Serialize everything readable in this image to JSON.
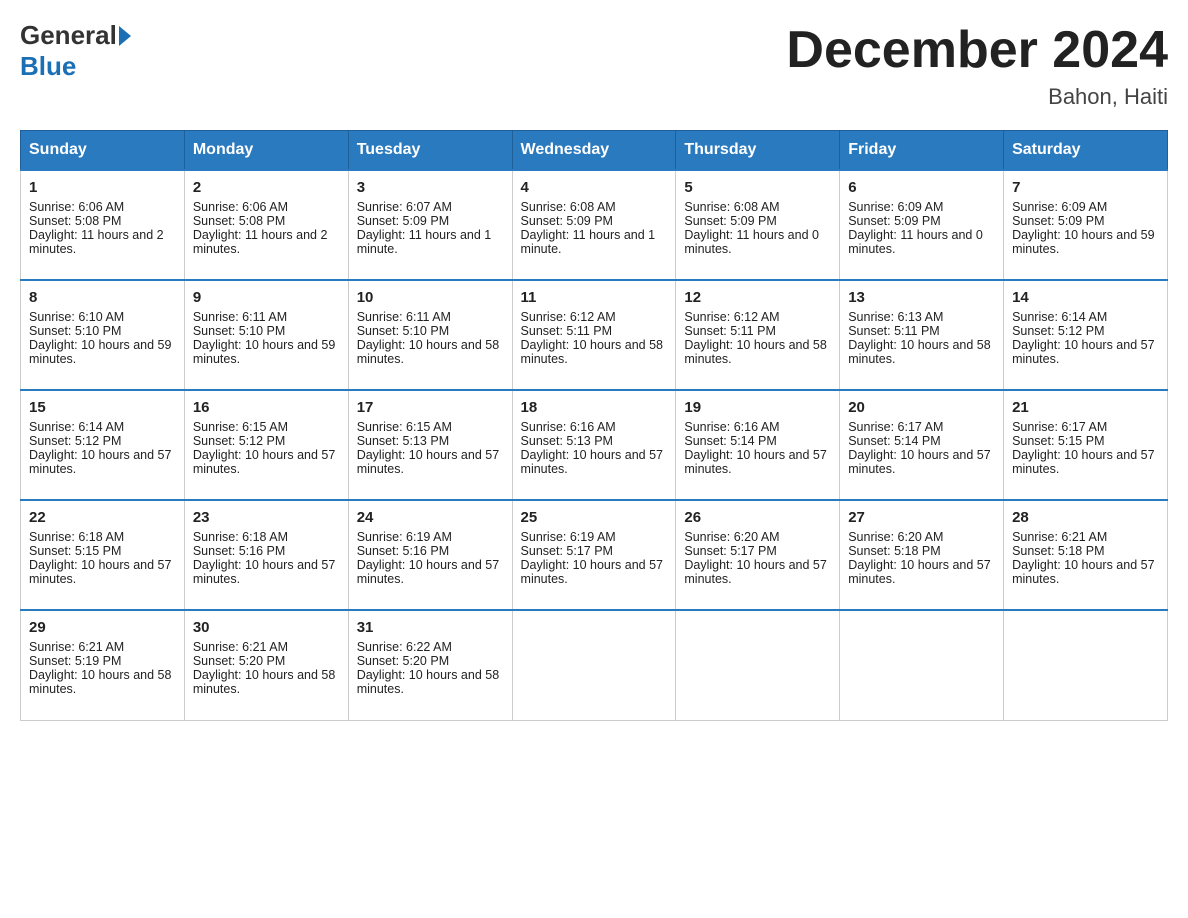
{
  "header": {
    "logo_general": "General",
    "logo_blue": "Blue",
    "month_title": "December 2024",
    "location": "Bahon, Haiti"
  },
  "days_of_week": [
    "Sunday",
    "Monday",
    "Tuesday",
    "Wednesday",
    "Thursday",
    "Friday",
    "Saturday"
  ],
  "weeks": [
    [
      {
        "day": "1",
        "sunrise": "6:06 AM",
        "sunset": "5:08 PM",
        "daylight": "11 hours and 2 minutes."
      },
      {
        "day": "2",
        "sunrise": "6:06 AM",
        "sunset": "5:08 PM",
        "daylight": "11 hours and 2 minutes."
      },
      {
        "day": "3",
        "sunrise": "6:07 AM",
        "sunset": "5:09 PM",
        "daylight": "11 hours and 1 minute."
      },
      {
        "day": "4",
        "sunrise": "6:08 AM",
        "sunset": "5:09 PM",
        "daylight": "11 hours and 1 minute."
      },
      {
        "day": "5",
        "sunrise": "6:08 AM",
        "sunset": "5:09 PM",
        "daylight": "11 hours and 0 minutes."
      },
      {
        "day": "6",
        "sunrise": "6:09 AM",
        "sunset": "5:09 PM",
        "daylight": "11 hours and 0 minutes."
      },
      {
        "day": "7",
        "sunrise": "6:09 AM",
        "sunset": "5:09 PM",
        "daylight": "10 hours and 59 minutes."
      }
    ],
    [
      {
        "day": "8",
        "sunrise": "6:10 AM",
        "sunset": "5:10 PM",
        "daylight": "10 hours and 59 minutes."
      },
      {
        "day": "9",
        "sunrise": "6:11 AM",
        "sunset": "5:10 PM",
        "daylight": "10 hours and 59 minutes."
      },
      {
        "day": "10",
        "sunrise": "6:11 AM",
        "sunset": "5:10 PM",
        "daylight": "10 hours and 58 minutes."
      },
      {
        "day": "11",
        "sunrise": "6:12 AM",
        "sunset": "5:11 PM",
        "daylight": "10 hours and 58 minutes."
      },
      {
        "day": "12",
        "sunrise": "6:12 AM",
        "sunset": "5:11 PM",
        "daylight": "10 hours and 58 minutes."
      },
      {
        "day": "13",
        "sunrise": "6:13 AM",
        "sunset": "5:11 PM",
        "daylight": "10 hours and 58 minutes."
      },
      {
        "day": "14",
        "sunrise": "6:14 AM",
        "sunset": "5:12 PM",
        "daylight": "10 hours and 57 minutes."
      }
    ],
    [
      {
        "day": "15",
        "sunrise": "6:14 AM",
        "sunset": "5:12 PM",
        "daylight": "10 hours and 57 minutes."
      },
      {
        "day": "16",
        "sunrise": "6:15 AM",
        "sunset": "5:12 PM",
        "daylight": "10 hours and 57 minutes."
      },
      {
        "day": "17",
        "sunrise": "6:15 AM",
        "sunset": "5:13 PM",
        "daylight": "10 hours and 57 minutes."
      },
      {
        "day": "18",
        "sunrise": "6:16 AM",
        "sunset": "5:13 PM",
        "daylight": "10 hours and 57 minutes."
      },
      {
        "day": "19",
        "sunrise": "6:16 AM",
        "sunset": "5:14 PM",
        "daylight": "10 hours and 57 minutes."
      },
      {
        "day": "20",
        "sunrise": "6:17 AM",
        "sunset": "5:14 PM",
        "daylight": "10 hours and 57 minutes."
      },
      {
        "day": "21",
        "sunrise": "6:17 AM",
        "sunset": "5:15 PM",
        "daylight": "10 hours and 57 minutes."
      }
    ],
    [
      {
        "day": "22",
        "sunrise": "6:18 AM",
        "sunset": "5:15 PM",
        "daylight": "10 hours and 57 minutes."
      },
      {
        "day": "23",
        "sunrise": "6:18 AM",
        "sunset": "5:16 PM",
        "daylight": "10 hours and 57 minutes."
      },
      {
        "day": "24",
        "sunrise": "6:19 AM",
        "sunset": "5:16 PM",
        "daylight": "10 hours and 57 minutes."
      },
      {
        "day": "25",
        "sunrise": "6:19 AM",
        "sunset": "5:17 PM",
        "daylight": "10 hours and 57 minutes."
      },
      {
        "day": "26",
        "sunrise": "6:20 AM",
        "sunset": "5:17 PM",
        "daylight": "10 hours and 57 minutes."
      },
      {
        "day": "27",
        "sunrise": "6:20 AM",
        "sunset": "5:18 PM",
        "daylight": "10 hours and 57 minutes."
      },
      {
        "day": "28",
        "sunrise": "6:21 AM",
        "sunset": "5:18 PM",
        "daylight": "10 hours and 57 minutes."
      }
    ],
    [
      {
        "day": "29",
        "sunrise": "6:21 AM",
        "sunset": "5:19 PM",
        "daylight": "10 hours and 58 minutes."
      },
      {
        "day": "30",
        "sunrise": "6:21 AM",
        "sunset": "5:20 PM",
        "daylight": "10 hours and 58 minutes."
      },
      {
        "day": "31",
        "sunrise": "6:22 AM",
        "sunset": "5:20 PM",
        "daylight": "10 hours and 58 minutes."
      },
      null,
      null,
      null,
      null
    ]
  ]
}
